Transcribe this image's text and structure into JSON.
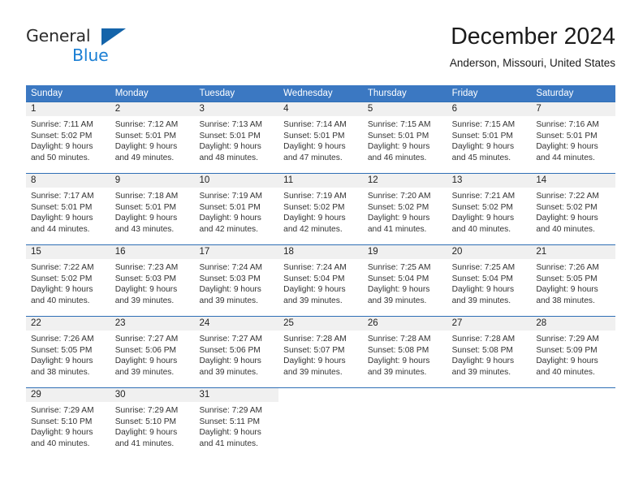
{
  "brand": {
    "line1": "General",
    "line2": "Blue",
    "triangle_color": "#1464aa",
    "blue_color": "#1b7fd4"
  },
  "header": {
    "title": "December 2024",
    "subtitle": "Anderson, Missouri, United States"
  },
  "theme": {
    "header_row_bg": "#3b78c2",
    "header_row_text": "#ffffff",
    "day_number_bg": "#f0f0f0",
    "week_divider": "#2f6fb5",
    "body_bg": "#ffffff"
  },
  "weekdays": [
    "Sunday",
    "Monday",
    "Tuesday",
    "Wednesday",
    "Thursday",
    "Friday",
    "Saturday"
  ],
  "weeks": [
    [
      {
        "day": "1",
        "sunrise": "Sunrise: 7:11 AM",
        "sunset": "Sunset: 5:02 PM",
        "daylight_line1": "Daylight: 9 hours",
        "daylight_line2": "and 50 minutes."
      },
      {
        "day": "2",
        "sunrise": "Sunrise: 7:12 AM",
        "sunset": "Sunset: 5:01 PM",
        "daylight_line1": "Daylight: 9 hours",
        "daylight_line2": "and 49 minutes."
      },
      {
        "day": "3",
        "sunrise": "Sunrise: 7:13 AM",
        "sunset": "Sunset: 5:01 PM",
        "daylight_line1": "Daylight: 9 hours",
        "daylight_line2": "and 48 minutes."
      },
      {
        "day": "4",
        "sunrise": "Sunrise: 7:14 AM",
        "sunset": "Sunset: 5:01 PM",
        "daylight_line1": "Daylight: 9 hours",
        "daylight_line2": "and 47 minutes."
      },
      {
        "day": "5",
        "sunrise": "Sunrise: 7:15 AM",
        "sunset": "Sunset: 5:01 PM",
        "daylight_line1": "Daylight: 9 hours",
        "daylight_line2": "and 46 minutes."
      },
      {
        "day": "6",
        "sunrise": "Sunrise: 7:15 AM",
        "sunset": "Sunset: 5:01 PM",
        "daylight_line1": "Daylight: 9 hours",
        "daylight_line2": "and 45 minutes."
      },
      {
        "day": "7",
        "sunrise": "Sunrise: 7:16 AM",
        "sunset": "Sunset: 5:01 PM",
        "daylight_line1": "Daylight: 9 hours",
        "daylight_line2": "and 44 minutes."
      }
    ],
    [
      {
        "day": "8",
        "sunrise": "Sunrise: 7:17 AM",
        "sunset": "Sunset: 5:01 PM",
        "daylight_line1": "Daylight: 9 hours",
        "daylight_line2": "and 44 minutes."
      },
      {
        "day": "9",
        "sunrise": "Sunrise: 7:18 AM",
        "sunset": "Sunset: 5:01 PM",
        "daylight_line1": "Daylight: 9 hours",
        "daylight_line2": "and 43 minutes."
      },
      {
        "day": "10",
        "sunrise": "Sunrise: 7:19 AM",
        "sunset": "Sunset: 5:01 PM",
        "daylight_line1": "Daylight: 9 hours",
        "daylight_line2": "and 42 minutes."
      },
      {
        "day": "11",
        "sunrise": "Sunrise: 7:19 AM",
        "sunset": "Sunset: 5:02 PM",
        "daylight_line1": "Daylight: 9 hours",
        "daylight_line2": "and 42 minutes."
      },
      {
        "day": "12",
        "sunrise": "Sunrise: 7:20 AM",
        "sunset": "Sunset: 5:02 PM",
        "daylight_line1": "Daylight: 9 hours",
        "daylight_line2": "and 41 minutes."
      },
      {
        "day": "13",
        "sunrise": "Sunrise: 7:21 AM",
        "sunset": "Sunset: 5:02 PM",
        "daylight_line1": "Daylight: 9 hours",
        "daylight_line2": "and 40 minutes."
      },
      {
        "day": "14",
        "sunrise": "Sunrise: 7:22 AM",
        "sunset": "Sunset: 5:02 PM",
        "daylight_line1": "Daylight: 9 hours",
        "daylight_line2": "and 40 minutes."
      }
    ],
    [
      {
        "day": "15",
        "sunrise": "Sunrise: 7:22 AM",
        "sunset": "Sunset: 5:02 PM",
        "daylight_line1": "Daylight: 9 hours",
        "daylight_line2": "and 40 minutes."
      },
      {
        "day": "16",
        "sunrise": "Sunrise: 7:23 AM",
        "sunset": "Sunset: 5:03 PM",
        "daylight_line1": "Daylight: 9 hours",
        "daylight_line2": "and 39 minutes."
      },
      {
        "day": "17",
        "sunrise": "Sunrise: 7:24 AM",
        "sunset": "Sunset: 5:03 PM",
        "daylight_line1": "Daylight: 9 hours",
        "daylight_line2": "and 39 minutes."
      },
      {
        "day": "18",
        "sunrise": "Sunrise: 7:24 AM",
        "sunset": "Sunset: 5:04 PM",
        "daylight_line1": "Daylight: 9 hours",
        "daylight_line2": "and 39 minutes."
      },
      {
        "day": "19",
        "sunrise": "Sunrise: 7:25 AM",
        "sunset": "Sunset: 5:04 PM",
        "daylight_line1": "Daylight: 9 hours",
        "daylight_line2": "and 39 minutes."
      },
      {
        "day": "20",
        "sunrise": "Sunrise: 7:25 AM",
        "sunset": "Sunset: 5:04 PM",
        "daylight_line1": "Daylight: 9 hours",
        "daylight_line2": "and 39 minutes."
      },
      {
        "day": "21",
        "sunrise": "Sunrise: 7:26 AM",
        "sunset": "Sunset: 5:05 PM",
        "daylight_line1": "Daylight: 9 hours",
        "daylight_line2": "and 38 minutes."
      }
    ],
    [
      {
        "day": "22",
        "sunrise": "Sunrise: 7:26 AM",
        "sunset": "Sunset: 5:05 PM",
        "daylight_line1": "Daylight: 9 hours",
        "daylight_line2": "and 38 minutes."
      },
      {
        "day": "23",
        "sunrise": "Sunrise: 7:27 AM",
        "sunset": "Sunset: 5:06 PM",
        "daylight_line1": "Daylight: 9 hours",
        "daylight_line2": "and 39 minutes."
      },
      {
        "day": "24",
        "sunrise": "Sunrise: 7:27 AM",
        "sunset": "Sunset: 5:06 PM",
        "daylight_line1": "Daylight: 9 hours",
        "daylight_line2": "and 39 minutes."
      },
      {
        "day": "25",
        "sunrise": "Sunrise: 7:28 AM",
        "sunset": "Sunset: 5:07 PM",
        "daylight_line1": "Daylight: 9 hours",
        "daylight_line2": "and 39 minutes."
      },
      {
        "day": "26",
        "sunrise": "Sunrise: 7:28 AM",
        "sunset": "Sunset: 5:08 PM",
        "daylight_line1": "Daylight: 9 hours",
        "daylight_line2": "and 39 minutes."
      },
      {
        "day": "27",
        "sunrise": "Sunrise: 7:28 AM",
        "sunset": "Sunset: 5:08 PM",
        "daylight_line1": "Daylight: 9 hours",
        "daylight_line2": "and 39 minutes."
      },
      {
        "day": "28",
        "sunrise": "Sunrise: 7:29 AM",
        "sunset": "Sunset: 5:09 PM",
        "daylight_line1": "Daylight: 9 hours",
        "daylight_line2": "and 40 minutes."
      }
    ],
    [
      {
        "day": "29",
        "sunrise": "Sunrise: 7:29 AM",
        "sunset": "Sunset: 5:10 PM",
        "daylight_line1": "Daylight: 9 hours",
        "daylight_line2": "and 40 minutes."
      },
      {
        "day": "30",
        "sunrise": "Sunrise: 7:29 AM",
        "sunset": "Sunset: 5:10 PM",
        "daylight_line1": "Daylight: 9 hours",
        "daylight_line2": "and 41 minutes."
      },
      {
        "day": "31",
        "sunrise": "Sunrise: 7:29 AM",
        "sunset": "Sunset: 5:11 PM",
        "daylight_line1": "Daylight: 9 hours",
        "daylight_line2": "and 41 minutes."
      },
      {
        "day": "",
        "sunrise": "",
        "sunset": "",
        "daylight_line1": "",
        "daylight_line2": ""
      },
      {
        "day": "",
        "sunrise": "",
        "sunset": "",
        "daylight_line1": "",
        "daylight_line2": ""
      },
      {
        "day": "",
        "sunrise": "",
        "sunset": "",
        "daylight_line1": "",
        "daylight_line2": ""
      },
      {
        "day": "",
        "sunrise": "",
        "sunset": "",
        "daylight_line1": "",
        "daylight_line2": ""
      }
    ]
  ]
}
